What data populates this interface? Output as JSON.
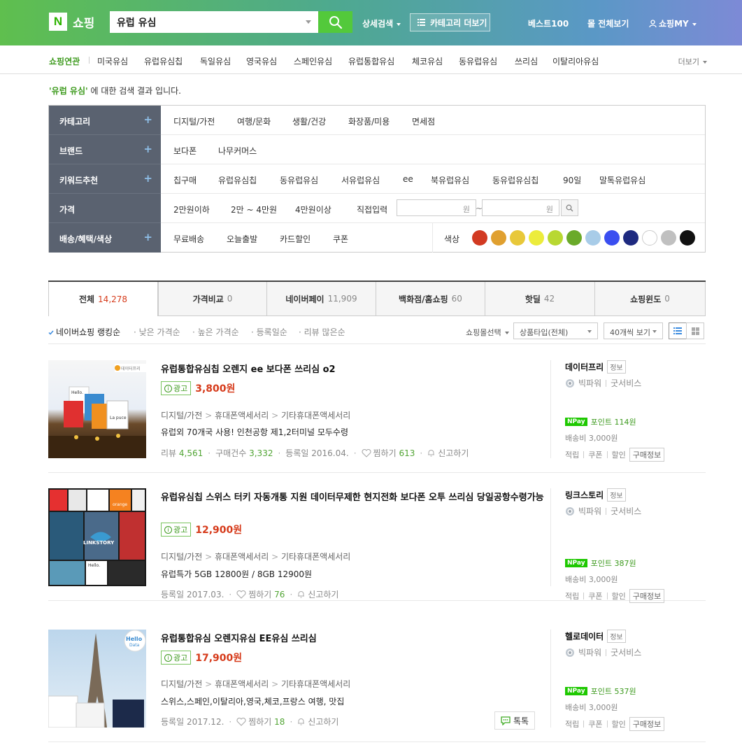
{
  "header": {
    "logo_letter": "N",
    "logo_text": "쇼핑",
    "search_value": "유럽 유심",
    "detail_search": "상세검색",
    "category_more": "카테고리 더보기",
    "best100": "베스트100",
    "all_malls": "몰 전체보기",
    "my_shopping": "쇼핑MY",
    "brand_color": "#5fbf4e"
  },
  "subnav": {
    "items": [
      "쇼핑연관",
      "미국유심",
      "유럽유심칩",
      "독일유심",
      "영국유심",
      "스페인유심",
      "유럽통합유심",
      "체코유심",
      "동유럽유심",
      "쓰리심",
      "이탈리아유심"
    ],
    "more": "더보기"
  },
  "result_message": {
    "keyword": "'유럽 유심'",
    "suffix": " 에 대한 검색 결과 입니다."
  },
  "filters": {
    "category": {
      "label": "카테고리",
      "values": [
        "디지털/가전",
        "여행/문화",
        "생활/건강",
        "화장품/미용",
        "면세점"
      ]
    },
    "brand": {
      "label": "브랜드",
      "values": [
        "보다폰",
        "나무커머스"
      ]
    },
    "keyword": {
      "label": "키워드추천",
      "values": [
        "칩구매",
        "유럽유심칩",
        "동유럽유심",
        "서유럽유심",
        "ee",
        "북유럽유심",
        "동유럽유심칩",
        "90일",
        "말톡유럽유심"
      ]
    },
    "price": {
      "label": "가격",
      "values": [
        "2만원이하",
        "2만 ~ 4만원",
        "4만원이상",
        "직접입력"
      ],
      "won": "원",
      "tilde": "~"
    },
    "delivery": {
      "label": "배송/혜택/색상",
      "values": [
        "무료배송",
        "오늘출발",
        "카드할인",
        "쿠폰"
      ],
      "color_label": "색상",
      "colors": [
        "#d23a22",
        "#e0a030",
        "#e8c83a",
        "#ecec3c",
        "#b8d832",
        "#6aaa2a",
        "#a8cce8",
        "#3a4ef0",
        "#1e2a80",
        "#ffffff",
        "#c0c0c0",
        "#111111"
      ]
    }
  },
  "tabs": [
    {
      "label": "전체",
      "count": "14,278"
    },
    {
      "label": "가격비교",
      "count": "0"
    },
    {
      "label": "네이버페이",
      "count": "11,909"
    },
    {
      "label": "백화점/홈쇼핑",
      "count": "60"
    },
    {
      "label": "핫딜",
      "count": "42"
    },
    {
      "label": "쇼핑윈도",
      "count": "0"
    }
  ],
  "sort": {
    "options": [
      "네이버쇼핑 랭킹순",
      "낮은 가격순",
      "높은 가격순",
      "등록일순",
      "리뷰 많은순"
    ],
    "mall_select": "쇼핑몰선택",
    "product_type": "상품타입(전체)",
    "per_page": "40개씩 보기"
  },
  "common": {
    "ad": "광고",
    "cat1": "디지털/가전",
    "cat2": "휴대폰액세서리",
    "cat3": "기타휴대폰액세서리",
    "gt": ">",
    "review": "리뷰",
    "purchase": "구매건수",
    "registered": "등록일",
    "wish": "찜하기",
    "report": "신고하기",
    "info": "정보",
    "bigpower": "빅파워",
    "goodservice": "굿서비스",
    "pay": "Pay",
    "point_label": "포인트",
    "shipping": "배송비 3,000원",
    "accum": "적립",
    "coupon": "쿠폰",
    "discount": "할인",
    "purchase_info": "구매정보",
    "talk": "톡톡"
  },
  "products": [
    {
      "title": "유럽통합유심칩 오렌지 ee 보다폰 쓰리심 o2",
      "price": "3,800원",
      "desc": "유럽외 70개국 사용! 인천공항 제1,2터미널 모두수령",
      "reviews": "4,561",
      "purchases": "3,332",
      "date": "2016.04.",
      "wish": "613",
      "mall": "데이터프리",
      "point": "114원",
      "thumb_label": "데이터프리",
      "thumb_text1": "Hello.",
      "thumb_text2": "La puce"
    },
    {
      "title": "유럽유심칩 스위스 터키 자동개통 지원 데이터무제한 현지전화 보다폰 오투 쓰리심 당일공항수령가능",
      "price": "12,900원",
      "desc": "유럽특가 5GB 12800원 / 8GB 12900원",
      "date": "2017.03.",
      "wish": "76",
      "mall": "링크스토리",
      "point": "387원",
      "thumb_label": "LINKSTORY",
      "thumb_text1": "orange",
      "thumb_text2": "Hello."
    },
    {
      "title": "유럽통합유심 오렌지유심 EE유심 쓰리심",
      "price": "17,900원",
      "desc": "스위스,스페인,이탈리아,영국,체코,프랑스 여행, 맛집",
      "date": "2017.12.",
      "wish": "18",
      "mall": "헬로데이터",
      "point": "537원",
      "thumb_label": "Hello",
      "thumb_text1": "Data"
    }
  ]
}
